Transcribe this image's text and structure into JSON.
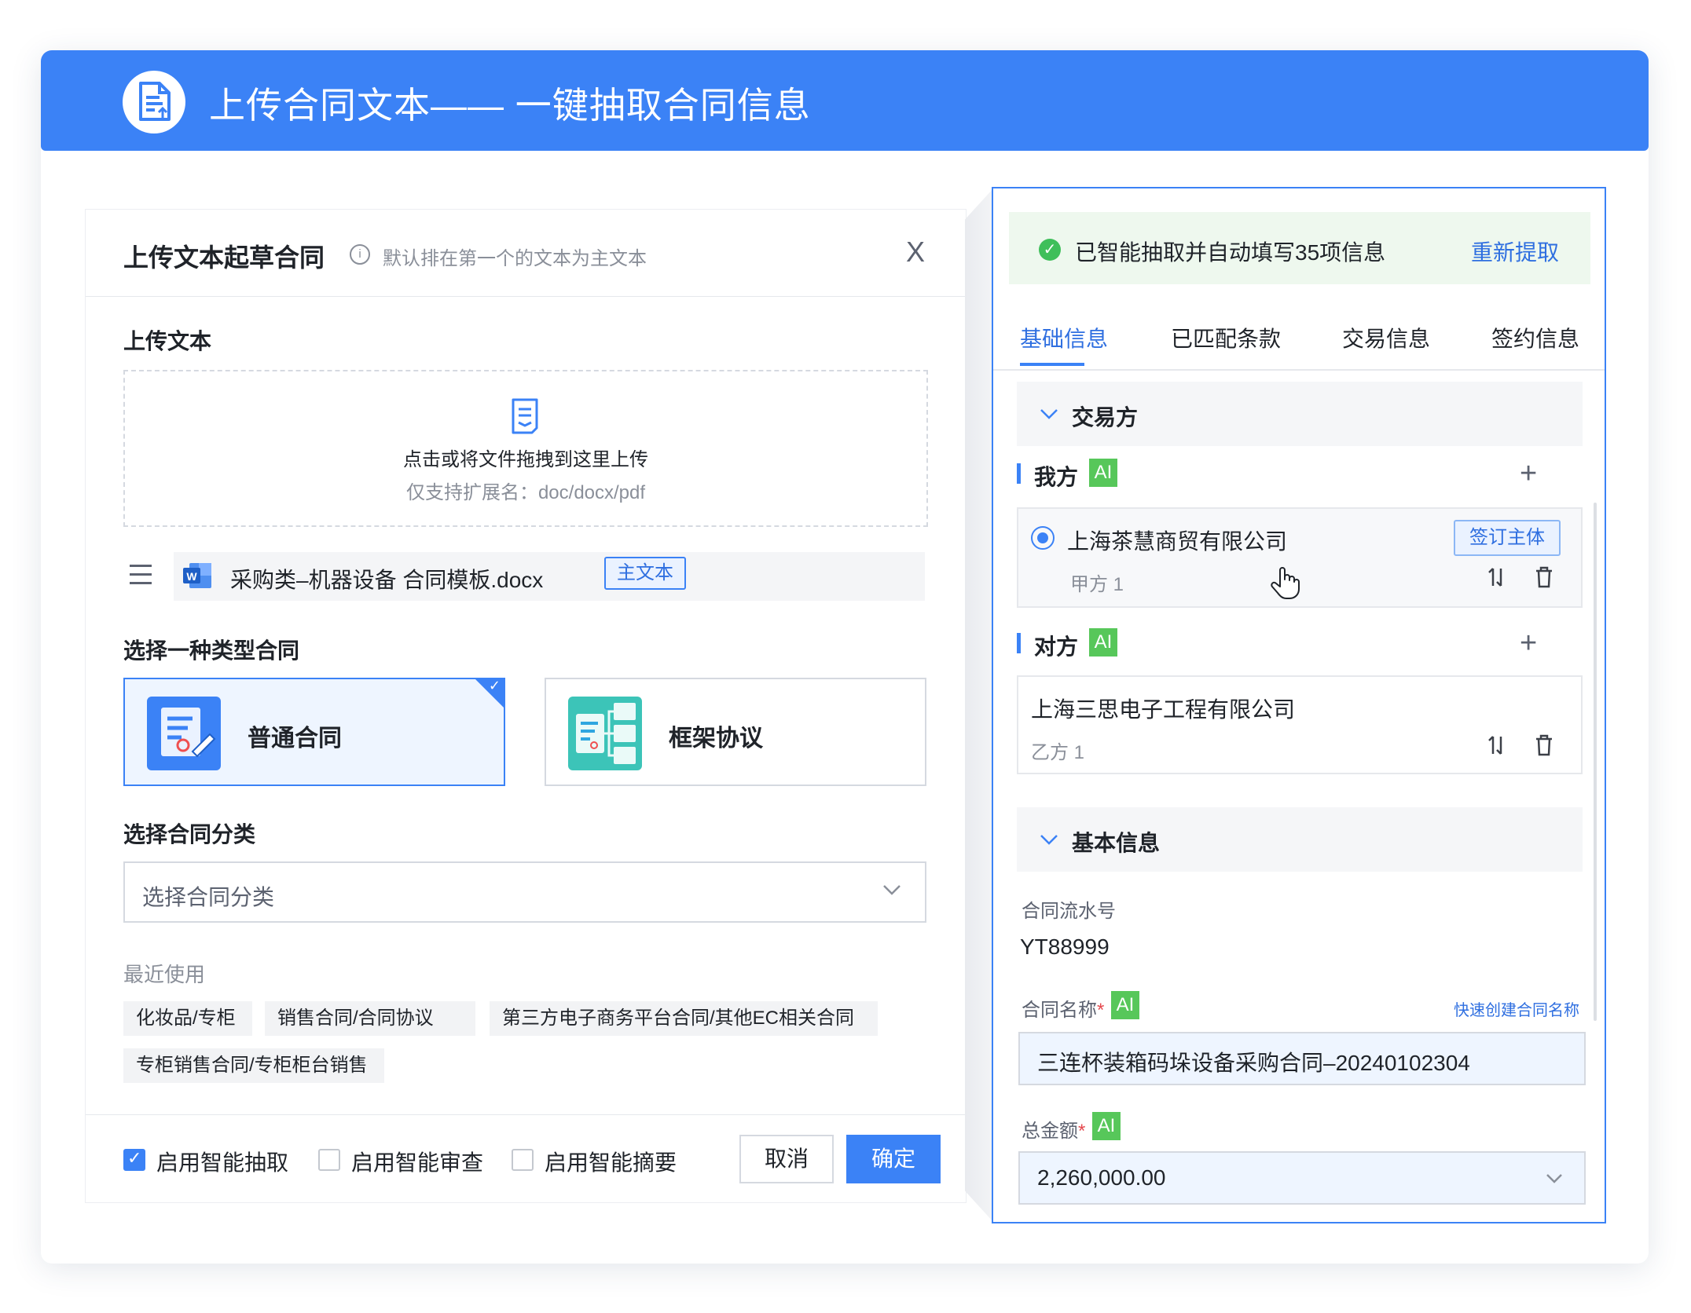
{
  "banner": {
    "title": "上传合同文本—— 一键抽取合同信息",
    "icon": "document-upload-icon",
    "color": "#3b82f6"
  },
  "dialog": {
    "title": "上传文本起草合同",
    "hint": "默认排在第一个的文本为主文本",
    "close": "X",
    "upload_label": "上传文本",
    "dropzone": {
      "main": "点击或将文件拖拽到这里上传",
      "sub": "仅支持扩展名：doc/docx/pdf"
    },
    "file": {
      "name": "采购类–机器设备 合同模板.docx",
      "tag": "主文本"
    },
    "type_label": "选择一种类型合同",
    "types": [
      {
        "label": "普通合同",
        "selected": true
      },
      {
        "label": "框架协议",
        "selected": false
      }
    ],
    "category_label": "选择合同分类",
    "category_placeholder": "选择合同分类",
    "recent_label": "最近使用",
    "recent": [
      "化妆品/专柜",
      "销售合同/合同协议",
      "第三方电子商务平台合同/其他EC相关合同",
      "专柜销售合同/专柜柜台销售"
    ],
    "options": [
      {
        "label": "启用智能抽取",
        "checked": true
      },
      {
        "label": "启用智能审查",
        "checked": false
      },
      {
        "label": "启用智能摘要",
        "checked": false
      }
    ],
    "cancel": "取消",
    "confirm": "确定"
  },
  "panel": {
    "status": "已智能抽取并自动填写35项信息",
    "refetch": "重新提取",
    "tabs": [
      "基础信息",
      "已匹配条款",
      "交易信息",
      "签约信息"
    ],
    "active_tab": "基础信息",
    "group1": "交易方",
    "ai": "AI",
    "our_party": {
      "label": "我方",
      "name": "上海茶慧商贸有限公司",
      "role": "甲方 1",
      "sign_tag": "签订主体"
    },
    "counter_party": {
      "label": "对方",
      "name": "上海三思电子工程有限公司",
      "role": "乙方 1"
    },
    "group2": "基本信息",
    "serial_label": "合同流水号",
    "serial_value": "YT88999",
    "name_label": "合同名称",
    "name_required": "*",
    "quick_create": "快速创建合同名称",
    "name_value": "三连杯装箱码垛设备采购合同–20240102304",
    "amount_label": "总金额",
    "amount_required": "*",
    "amount_value": "2,260,000.00"
  }
}
